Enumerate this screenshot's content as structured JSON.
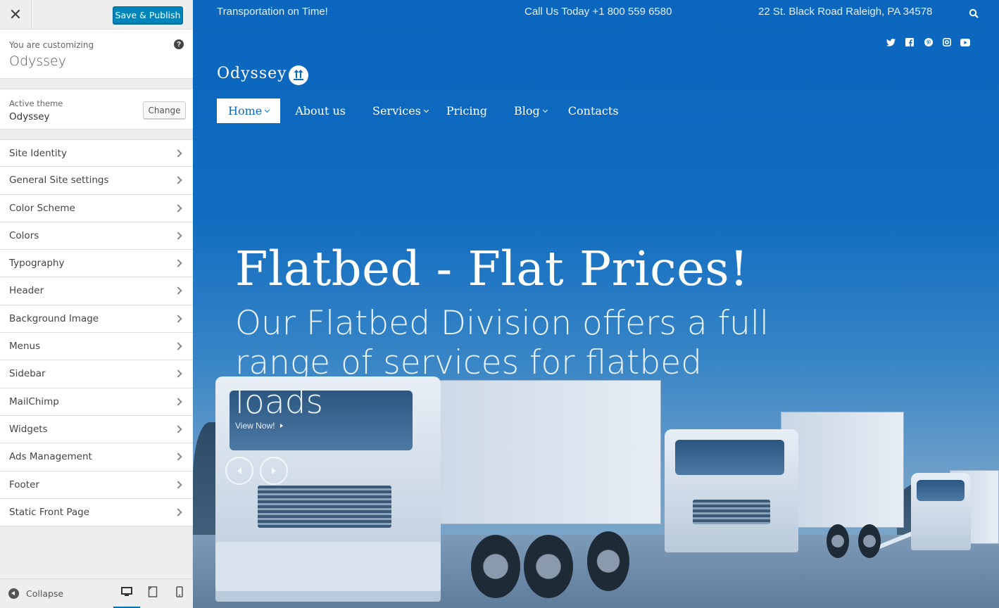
{
  "customizer": {
    "close_glyph": "✕",
    "publish_label": "Save & Publish",
    "info": {
      "pre_title": "You are customizing",
      "site_name": "Odyssey",
      "help_glyph": "?"
    },
    "theme": {
      "label": "Active theme",
      "name": "Odyssey",
      "change_label": "Change"
    },
    "sections": [
      {
        "label": "Site Identity"
      },
      {
        "label": "General Site settings"
      },
      {
        "label": "Color Scheme"
      },
      {
        "label": "Colors"
      },
      {
        "label": "Typography"
      },
      {
        "label": "Header"
      },
      {
        "label": "Background Image"
      },
      {
        "label": "Menus"
      },
      {
        "label": "Sidebar"
      },
      {
        "label": "MailChimp"
      },
      {
        "label": "Widgets"
      },
      {
        "label": "Ads Management"
      },
      {
        "label": "Footer"
      },
      {
        "label": "Static Front Page"
      }
    ],
    "footer": {
      "collapse_label": "Collapse",
      "devices": [
        "desktop-icon",
        "tablet-icon",
        "mobile-icon"
      ],
      "active_device": "desktop"
    },
    "accent_color": "#0085ba"
  },
  "site": {
    "topbar": {
      "tagline": "Transportation on Time!",
      "phone": "Call Us Today +1 800 559 6580",
      "address": "22 St. Black Road Raleigh, PA 34578"
    },
    "social_icons": [
      "twitter-icon",
      "facebook-icon",
      "pinterest-icon",
      "instagram-icon",
      "youtube-icon"
    ],
    "logo_text": "Odyssey",
    "nav": [
      {
        "label": "Home",
        "has_submenu": true,
        "active": true
      },
      {
        "label": "About us",
        "has_submenu": false
      },
      {
        "label": "Services",
        "has_submenu": true
      },
      {
        "label": "Pricing",
        "has_submenu": false
      },
      {
        "label": "Blog",
        "has_submenu": true
      },
      {
        "label": "Contacts",
        "has_submenu": false
      }
    ],
    "hero": {
      "title": "Flatbed - Flat Prices!",
      "subtitle": "Our Flatbed Division offers a full range of services for flatbed loads",
      "cta": "View Now!"
    },
    "brand_color": "#0b6abf"
  }
}
